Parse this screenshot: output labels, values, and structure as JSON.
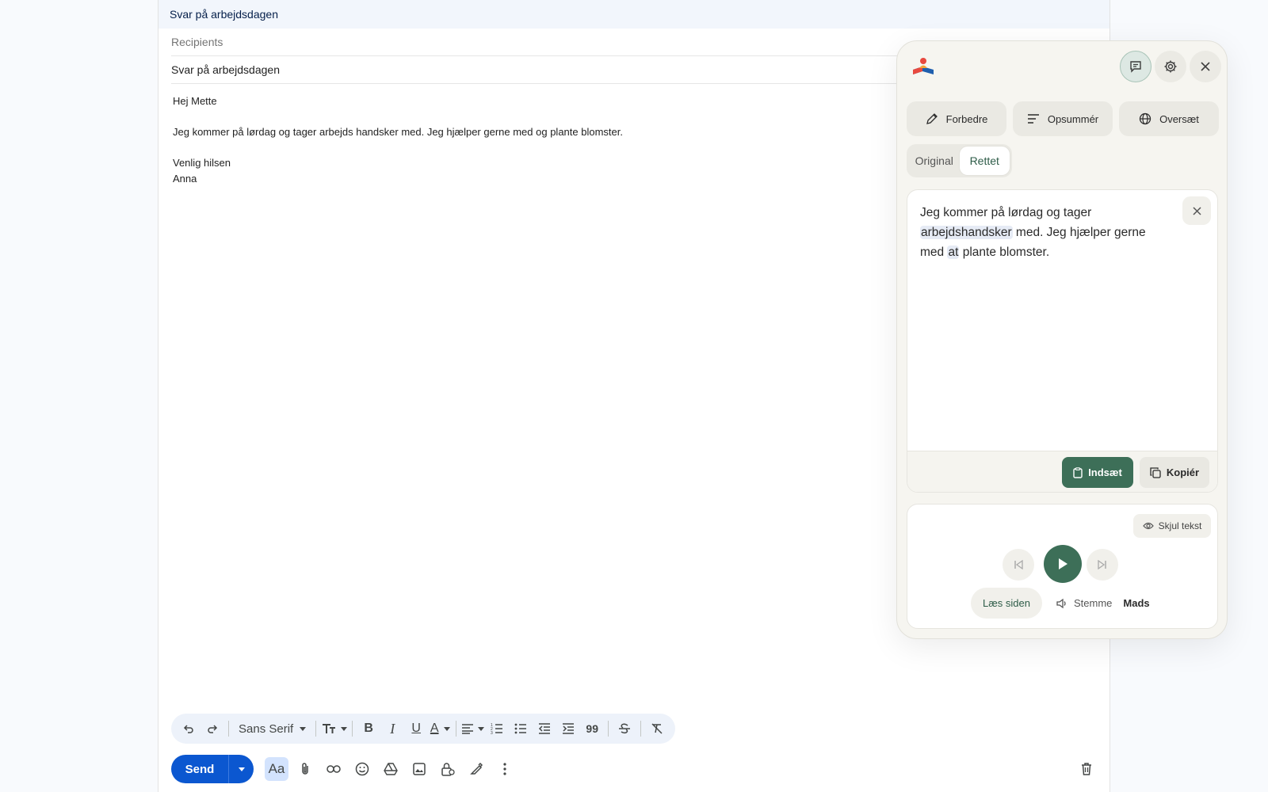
{
  "compose": {
    "header_title": "Svar på arbejdsdagen",
    "recipients_placeholder": "Recipients",
    "subject": "Svar på arbejdsdagen",
    "body_lines": [
      "Hej Mette",
      "",
      "Jeg kommer på lørdag og tager arbejds handsker med. Jeg hjælper gerne med og plante blomster.",
      "",
      "Venlig hilsen",
      "Anna"
    ]
  },
  "toolbar": {
    "font_name": "Sans Serif",
    "send_label": "Send",
    "aa_label": "Aa"
  },
  "panel": {
    "actions": [
      {
        "label": "Forbedre",
        "icon": "pencil-icon"
      },
      {
        "label": "Opsummér",
        "icon": "lines-icon"
      },
      {
        "label": "Oversæt",
        "icon": "globe-icon"
      }
    ],
    "tabs": {
      "original": "Original",
      "corrected": "Rettet",
      "selected": "Rettet"
    },
    "result_text": {
      "p1": "Jeg kommer på lørdag og tager ",
      "h1": "arbejdshandsker",
      "p2": " med. Jeg hjælper gerne med ",
      "h2": "at",
      "p3": " plante blomster."
    },
    "insert_label": "Indsæt",
    "copy_label": "Kopiér",
    "hide_text_label": "Skjul tekst",
    "read_page_label": "Læs siden",
    "voice_label": "Stemme",
    "voice_name": "Mads",
    "colors": {
      "accent": "#3d6f58",
      "send": "#0b57d0"
    }
  }
}
